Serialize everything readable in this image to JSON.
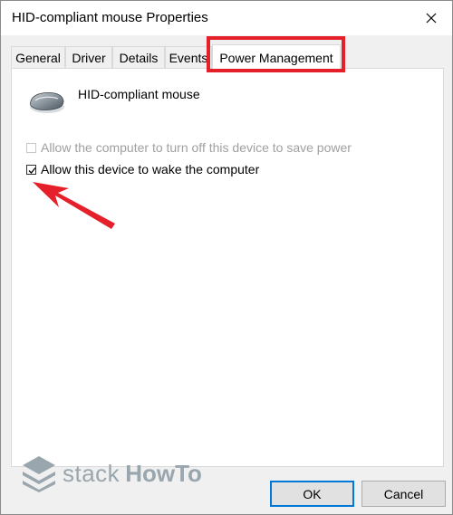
{
  "window": {
    "title": "HID-compliant mouse Properties"
  },
  "tabs": [
    {
      "label": "General"
    },
    {
      "label": "Driver"
    },
    {
      "label": "Details"
    },
    {
      "label": "Events"
    },
    {
      "label": "Power Management",
      "active": true
    }
  ],
  "device": {
    "name": "HID-compliant mouse",
    "icon": "mouse-icon"
  },
  "options": [
    {
      "label": "Allow the computer to turn off this device to save power",
      "checked": false,
      "enabled": false
    },
    {
      "label": "Allow this device to wake the computer",
      "checked": true,
      "enabled": true
    }
  ],
  "buttons": {
    "ok": "OK",
    "cancel": "Cancel"
  },
  "watermark": {
    "part1": "stack",
    "part2": "HowTo"
  },
  "colors": {
    "highlight": "#e5202a",
    "default_button_border": "#0078d7"
  }
}
